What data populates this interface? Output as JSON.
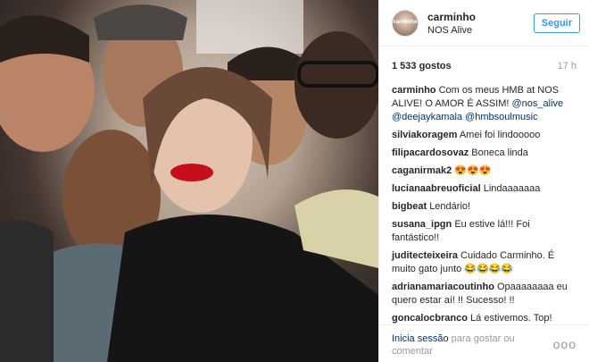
{
  "post": {
    "username": "carminho",
    "location": "NOS Alive",
    "avatar_text": "carminho",
    "follow_label": "Seguir",
    "likes": "1 533 gostos",
    "time": "17 h"
  },
  "caption": {
    "user": "carminho",
    "text_before": "Com os meus HMB at NOS ALIVE!",
    "line2": "O AMOR É ASSIM!",
    "mention1": "@nos_alive",
    "mention2": "@deejaykamala",
    "mention3": "@hmbsoulmusic"
  },
  "comments": [
    {
      "user": "silviakoragem",
      "text": "Amei foi lindooooo"
    },
    {
      "user": "filipacardosovaz",
      "text": "Boneca linda"
    },
    {
      "user": "caganirmak2",
      "text": "😍😍😍"
    },
    {
      "user": "lucianaabreuoficial",
      "text": "Lindaaaaaaa"
    },
    {
      "user": "bigbeat",
      "text": "Lendário!"
    },
    {
      "user": "susana_ipgn",
      "text": "Eu estive lá!!! Foi fantástico!!"
    },
    {
      "user": "juditecteixeira",
      "text": "Cuidado Carminho. É muito gato junto 😂😂😂😂"
    },
    {
      "user": "adrianamariacoutinho",
      "text": "Opaaaaaaaa eu quero estar aí! !! Sucesso! !!"
    },
    {
      "user": "goncalocbranco",
      "text": "Lá estivemos. Top!"
    }
  ],
  "footer": {
    "login": "Inicia sessão",
    "rest": "para gostar ou comentar",
    "more": "ooo"
  },
  "colors": {
    "accent": "#3897f0",
    "link": "#003569"
  }
}
